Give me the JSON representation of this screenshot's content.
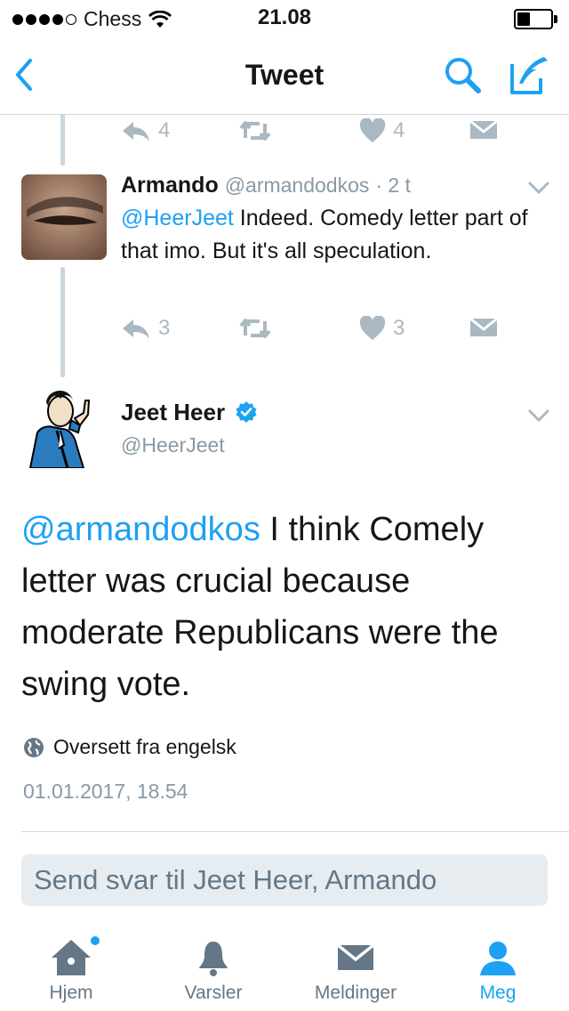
{
  "status_bar": {
    "carrier": "Chess",
    "time": "21.08"
  },
  "nav": {
    "title": "Tweet"
  },
  "colors": {
    "accent": "#1da1f2",
    "muted": "#aab8c2",
    "text": "#14171a",
    "secondary": "#657786"
  },
  "prev_tweet_actions": {
    "replies": "4",
    "likes": "4"
  },
  "reply_tweet": {
    "name": "Armando",
    "handle": "@armandodkos",
    "time": "· 2 t",
    "mention": "@HeerJeet",
    "text": " Indeed. Comedy letter part of that imo. But it's all speculation.",
    "replies": "3",
    "likes": "3"
  },
  "main_tweet": {
    "name": "Jeet Heer",
    "handle": "@HeerJeet",
    "mention": "@armandodkos",
    "text": " I think Comely letter was crucial because moderate Republicans were the swing vote.",
    "translate": "Oversett fra engelsk",
    "timestamp": "01.01.2017, 18.54"
  },
  "reply_box": {
    "placeholder": "Send svar til Jeet Heer, Armando"
  },
  "tabs": [
    {
      "label": "Hjem",
      "icon": "home-icon"
    },
    {
      "label": "Varsler",
      "icon": "bell-icon"
    },
    {
      "label": "Meldinger",
      "icon": "envelope-icon"
    },
    {
      "label": "Meg",
      "icon": "person-icon",
      "active": true
    }
  ]
}
